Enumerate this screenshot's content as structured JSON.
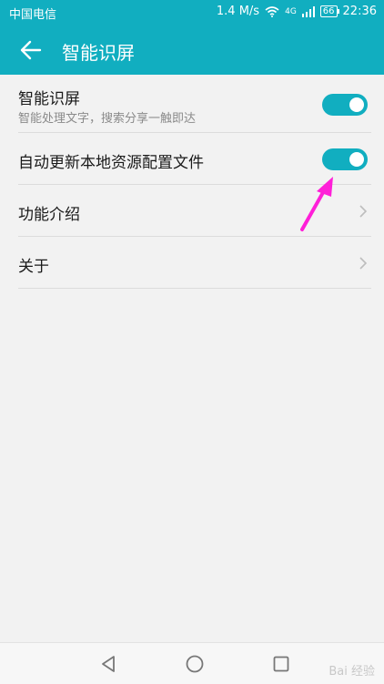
{
  "status_bar": {
    "carrier": "中国电信",
    "speed": "1.4 M/s",
    "network": "4G",
    "battery": "66",
    "time": "22:36"
  },
  "app_bar": {
    "title": "智能识屏",
    "back_icon": "arrow-left-icon"
  },
  "settings": {
    "items": [
      {
        "title": "智能识屏",
        "subtitle": "智能处理文字，搜索分享一触即达",
        "control": "toggle",
        "enabled": true
      },
      {
        "title": "自动更新本地资源配置文件",
        "control": "toggle",
        "enabled": true
      },
      {
        "title": "功能介绍",
        "control": "chevron"
      },
      {
        "title": "关于",
        "control": "chevron"
      }
    ]
  },
  "nav_bar": {
    "buttons": [
      "back-triangle-icon",
      "home-circle-icon",
      "recent-square-icon"
    ]
  },
  "watermark": "Bai 经验",
  "colors": {
    "accent": "#11aec0",
    "annotation_arrow": "#ff1fd8"
  }
}
